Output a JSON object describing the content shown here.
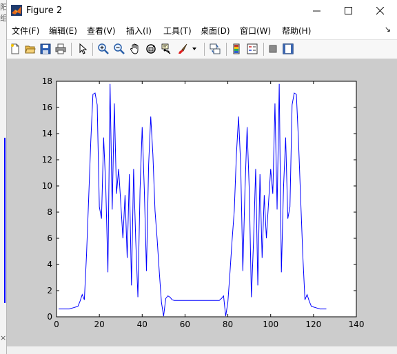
{
  "background_window": {
    "fragments": [
      "阳",
      "组",
      "×"
    ]
  },
  "window": {
    "title": "Figure 2",
    "controls": [
      "minimize-icon",
      "maximize-icon",
      "close-icon"
    ]
  },
  "menu": {
    "items": [
      "文件(F)",
      "编辑(E)",
      "查看(V)",
      "插入(I)",
      "工具(T)",
      "桌面(D)",
      "窗口(W)",
      "帮助(H)"
    ],
    "overflow": "↘"
  },
  "toolbar": {
    "icons": [
      "new-figure-icon",
      "open-file-icon",
      "save-icon",
      "print-icon",
      "pointer-icon",
      "zoom-in-icon",
      "zoom-out-icon",
      "pan-hand-icon",
      "rotate-3d-icon",
      "data-cursor-icon",
      "brush-icon",
      "brush-dropdown-icon",
      "link-plot-icon",
      "colorbar-icon",
      "legend-icon",
      "hide-plot-tools-icon",
      "show-plot-tools-icon"
    ]
  },
  "colors": {
    "line": "#0000ff",
    "figure_background": "#cccccc",
    "axes_background": "#ffffff"
  },
  "chart_data": {
    "type": "line",
    "title": "",
    "xlabel": "",
    "ylabel": "",
    "xlim": [
      0,
      140
    ],
    "ylim": [
      0,
      18
    ],
    "xticks": [
      "0",
      "20",
      "40",
      "60",
      "80",
      "100",
      "120",
      "140"
    ],
    "yticks": [
      "0",
      "2",
      "4",
      "6",
      "8",
      "10",
      "12",
      "14",
      "16",
      "18"
    ],
    "grid": false,
    "series": [
      {
        "x": [
          1,
          2,
          3,
          4,
          5,
          6,
          7,
          8,
          9,
          10,
          11,
          12,
          13,
          14,
          15,
          16,
          17,
          18,
          19,
          20,
          21,
          22,
          23,
          24,
          25,
          26,
          27,
          28,
          29,
          30,
          31,
          32,
          33,
          34,
          35,
          36,
          37,
          38,
          39,
          40,
          41,
          42,
          43,
          44,
          45,
          46,
          47,
          48,
          49,
          50,
          51,
          52,
          53,
          54,
          55,
          56,
          57,
          58,
          59,
          60,
          61,
          62,
          63,
          64,
          65,
          66,
          67,
          68,
          69,
          70,
          71,
          72,
          73,
          74,
          75,
          76,
          77,
          78,
          79,
          80,
          81,
          82,
          83,
          84,
          85,
          86,
          87,
          88,
          89,
          90,
          91,
          92,
          93,
          94,
          95,
          96,
          97,
          98,
          99,
          100,
          101,
          102,
          103,
          104,
          105,
          106,
          107,
          108,
          109,
          110,
          111,
          112,
          113,
          114,
          115,
          116,
          117,
          118,
          119,
          120,
          121,
          122,
          123,
          124,
          125,
          126
        ],
        "y": [
          0.6,
          0.6,
          0.6,
          0.6,
          0.6,
          0.6,
          0.65,
          0.7,
          0.75,
          0.8,
          1.2,
          1.7,
          1.3,
          4.7,
          9.0,
          13.4,
          17.0,
          17.1,
          16.2,
          8.4,
          7.5,
          13.7,
          9.9,
          3.4,
          17.8,
          8.2,
          16.3,
          9.4,
          11.3,
          8.7,
          6.0,
          9.3,
          4.5,
          10.9,
          2.4,
          11.3,
          5.8,
          1.5,
          9.7,
          14.5,
          9.7,
          3.5,
          11.6,
          15.3,
          12.4,
          8.1,
          5.9,
          3.4,
          1.1,
          0.05,
          1.4,
          1.6,
          1.5,
          1.3,
          1.25,
          1.25,
          1.25,
          1.25,
          1.25,
          1.25,
          1.25,
          1.25,
          1.25,
          1.25,
          1.25,
          1.25,
          1.25,
          1.25,
          1.25,
          1.25,
          1.25,
          1.25,
          1.25,
          1.25,
          1.25,
          1.25,
          1.4,
          1.6,
          0.05,
          1.1,
          3.4,
          5.9,
          8.1,
          12.4,
          15.3,
          11.6,
          3.5,
          9.7,
          14.5,
          9.7,
          1.5,
          5.8,
          11.3,
          2.4,
          10.9,
          4.5,
          9.3,
          6.0,
          8.7,
          11.3,
          9.4,
          16.3,
          8.2,
          17.8,
          3.4,
          9.9,
          13.7,
          7.5,
          8.4,
          16.2,
          17.1,
          17.0,
          13.4,
          9.0,
          4.7,
          1.3,
          1.7,
          1.2,
          0.8,
          0.75,
          0.7,
          0.65,
          0.6,
          0.6,
          0.6,
          0.6
        ]
      }
    ]
  }
}
